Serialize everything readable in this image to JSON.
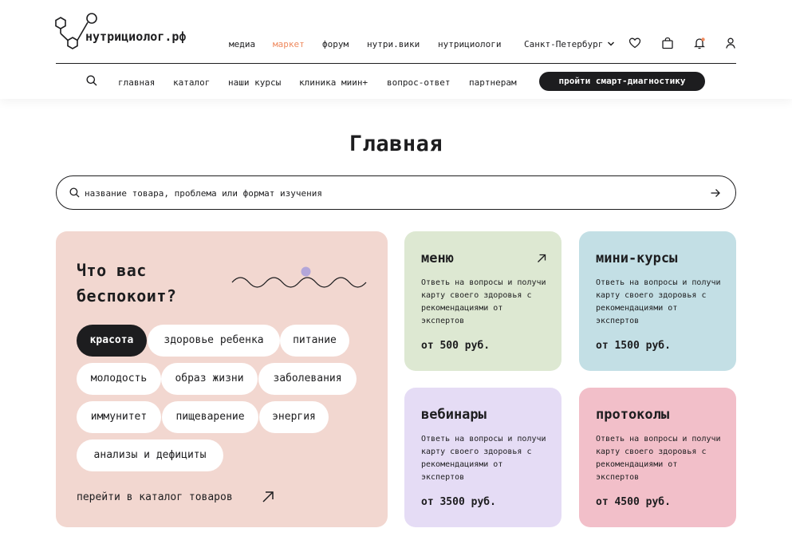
{
  "header": {
    "logo_text": "нутрициолог.рф",
    "nav": [
      {
        "label": "медиа",
        "active": false
      },
      {
        "label": "маркет",
        "active": true
      },
      {
        "label": "форум",
        "active": false
      },
      {
        "label": "нутри.вики",
        "active": false
      },
      {
        "label": "нутрициологи",
        "active": false
      }
    ],
    "city": "Санкт-Петербург",
    "icons": [
      "heart-icon",
      "bag-icon",
      "bell-icon",
      "user-icon"
    ],
    "accent_color": "#ef8a5f",
    "notification_dot_color": "#ef8a5f"
  },
  "subnav": {
    "items": [
      "главная",
      "каталог",
      "наши курсы",
      "клиника миин+",
      "вопрос-ответ",
      "партнерам"
    ],
    "cta": "пройти смарт-диагностику"
  },
  "page": {
    "title": "Главная"
  },
  "search": {
    "placeholder": "название товара, проблема или формат изучения"
  },
  "concerns": {
    "title": "Что вас беспокоит?",
    "tags": [
      {
        "label": "красота",
        "active": true
      },
      {
        "label": "здоровье ребенка",
        "active": false
      },
      {
        "label": "питание",
        "active": false
      },
      {
        "label": "молодость",
        "active": false
      },
      {
        "label": "образ жизни",
        "active": false
      },
      {
        "label": "заболевания",
        "active": false
      },
      {
        "label": "иммунитет",
        "active": false
      },
      {
        "label": "пищеварение",
        "active": false
      },
      {
        "label": "энергия",
        "active": false
      },
      {
        "label": "анализы и дефициты",
        "active": false
      }
    ],
    "catalog_link": "перейти в каталог товаров",
    "background": "#f2d7d0"
  },
  "cards": [
    {
      "title": "меню",
      "desc": "Ответь на вопросы и получи карту своего здоровья с рекомендациями от экспертов",
      "price": "от 500 руб.",
      "color": "#dde8d2",
      "arrow": true
    },
    {
      "title": "мини-курсы",
      "desc": "Ответь на вопросы и получи карту своего здоровья с рекомендациями от экспертов",
      "price": "от 1500 руб.",
      "color": "#c3dfe5",
      "arrow": false
    },
    {
      "title": "вебинары",
      "desc": "Ответь на вопросы и получи карту своего здоровья с рекомендациями от экспертов",
      "price": "от 3500 руб.",
      "color": "#e5dcf5",
      "arrow": false
    },
    {
      "title": "протоколы",
      "desc": "Ответь на вопросы и получи карту своего здоровья с рекомендациями от экспертов",
      "price": "от 4500 руб.",
      "color": "#f2bfc9",
      "arrow": false
    }
  ]
}
